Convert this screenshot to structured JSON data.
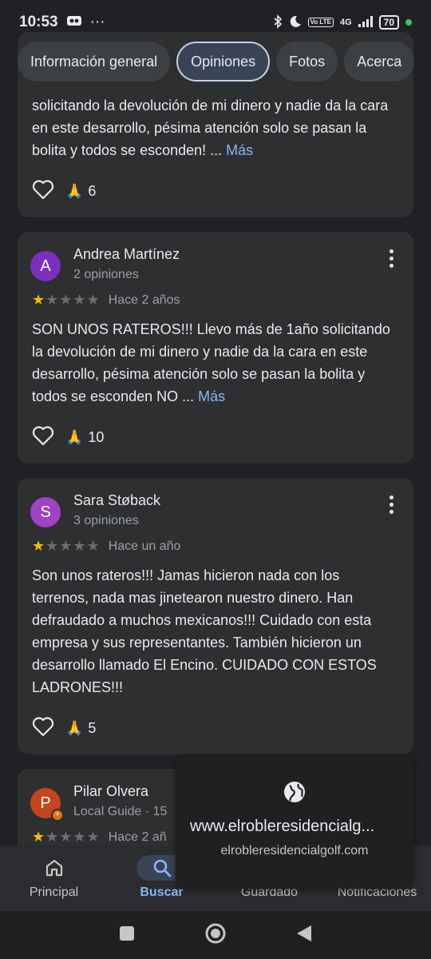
{
  "status": {
    "time": "10:53",
    "battery": "70",
    "network": "4G",
    "volte": "Vo LTE"
  },
  "tabs": [
    {
      "label": "Información general"
    },
    {
      "label": "Opiniones"
    },
    {
      "label": "Fotos"
    },
    {
      "label": "Acerca"
    }
  ],
  "reviews": [
    {
      "text": "solicitando la devolución de mi dinero y nadie da la cara en este desarrollo, pésima atención solo se pasan la bolita y todos se esconden! ...",
      "more": "Más",
      "count": "6"
    },
    {
      "initial": "A",
      "name": "Andrea Martínez",
      "meta": "2 opiniones",
      "time": "Hace 2 años",
      "text": "SON UNOS RATEROS!!! Llevo más de 1año solicitando la devolución de mi dinero y nadie da la cara en este desarrollo, pésima atención solo se pasan la bolita y todos se esconden NO ...",
      "more": "Más",
      "count": "10"
    },
    {
      "initial": "S",
      "name": "Sara Støback",
      "meta": "3 opiniones",
      "time": "Hace un año",
      "text": "Son unos rateros!!! Jamas hicieron nada con los terrenos, nada mas jinetearon nuestro dinero. Han defraudado a muchos mexicanos!!! Cuidado con esta empresa y sus representantes. También hicieron un desarrollo llamado El Encino. CUIDADO CON ESTOS LADRONES!!!",
      "count": "5"
    },
    {
      "initial": "P",
      "name": "Pilar Olvera",
      "meta": "Local Guide · 15",
      "time": "Hace 2 añ"
    }
  ],
  "popup": {
    "url": "www.elrobleresidencialg...",
    "domain": "elrobleresidencialgolf.com"
  },
  "nav": [
    {
      "label": "Principal"
    },
    {
      "label": "Buscar"
    },
    {
      "label": "Guardado"
    },
    {
      "label": "Notificaciones"
    }
  ],
  "colors": {
    "accent": "#8ab4f8",
    "star": "#fbbc04",
    "avatar_a": "#7b2fbf",
    "avatar_s": "#a142c4",
    "avatar_p": "#c5451d"
  }
}
